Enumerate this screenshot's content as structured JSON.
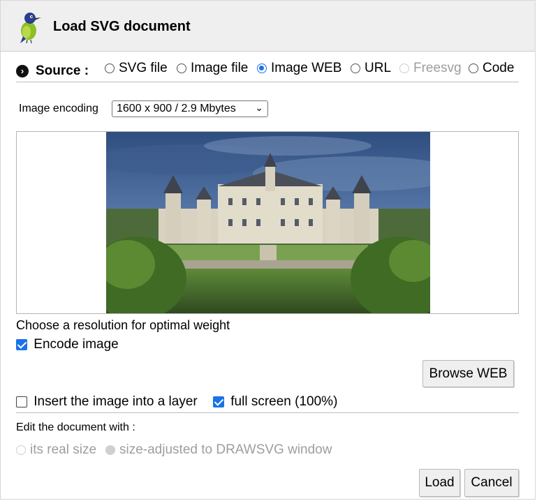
{
  "window": {
    "title": "Load SVG document"
  },
  "source": {
    "label": "Source :",
    "options": [
      {
        "label": "SVG file",
        "checked": false,
        "disabled": false
      },
      {
        "label": "Image file",
        "checked": false,
        "disabled": false
      },
      {
        "label": "Image WEB",
        "checked": true,
        "disabled": false
      },
      {
        "label": "URL",
        "checked": false,
        "disabled": false
      },
      {
        "label": "Freesvg",
        "checked": false,
        "disabled": true
      },
      {
        "label": "Code",
        "checked": false,
        "disabled": false
      }
    ]
  },
  "encoding": {
    "label": "Image encoding",
    "selected": "1600 x 900 / 2.9 Mbytes"
  },
  "resolution_hint": "Choose a resolution for optimal weight",
  "encode_image": {
    "label": "Encode image",
    "checked": true
  },
  "browse_button": "Browse WEB",
  "insert_layer": {
    "label": "Insert the image into a layer",
    "checked": false
  },
  "full_screen": {
    "label": "full screen (100%)",
    "checked": true
  },
  "edit_with": {
    "label": "Edit the document with :",
    "options": [
      {
        "label": "its real size",
        "checked": false
      },
      {
        "label": "size-adjusted to DRAWSVG window",
        "checked": true
      }
    ]
  },
  "buttons": {
    "load": "Load",
    "cancel": "Cancel"
  }
}
